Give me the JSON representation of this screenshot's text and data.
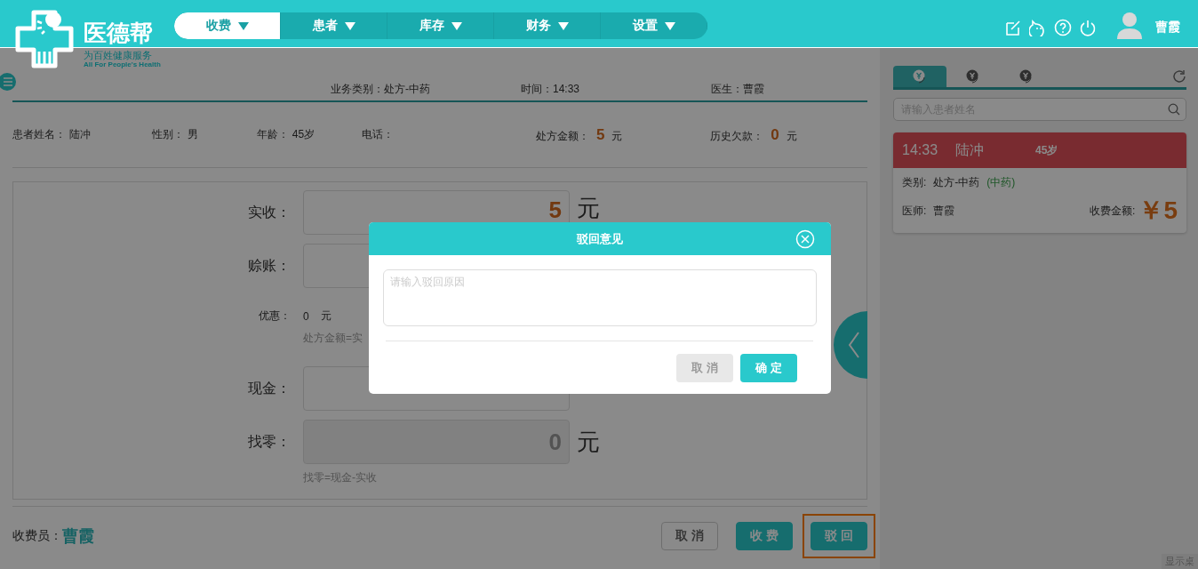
{
  "header": {
    "logo": {
      "name": "医德帮",
      "slogan": "为百姓健康服务",
      "slogan_en": "All For People's Health"
    },
    "nav": [
      {
        "label": "收费",
        "selected": true
      },
      {
        "label": "患者",
        "selected": false
      },
      {
        "label": "库存",
        "selected": false
      },
      {
        "label": "财务",
        "selected": false
      },
      {
        "label": "设置",
        "selected": false
      }
    ],
    "user_name": "曹霞"
  },
  "info_bar": {
    "business_type": "业务类别：处方-中药",
    "time": "时间：14:33",
    "doctor": "医生：曹霞"
  },
  "patient_fields": [
    {
      "kind": "text",
      "label": "患者姓名：",
      "value": "陆冲"
    },
    {
      "kind": "text",
      "label": "性别：",
      "value": "男"
    },
    {
      "kind": "text",
      "label": "年龄：",
      "value": "45岁"
    },
    {
      "kind": "text",
      "label": "电话："
    },
    {
      "kind": "amount",
      "label": "处方金额：",
      "value": "5",
      "unit": "元"
    },
    {
      "kind": "amount",
      "label": "历史欠款：",
      "value": "0",
      "unit": "元"
    }
  ],
  "payment_form": {
    "rows": [
      {
        "kind": "input",
        "label": "实收：",
        "value": "5",
        "unit": "元"
      },
      {
        "kind": "input",
        "label": "赊账："
      },
      {
        "kind": "small",
        "label": "优惠：",
        "value": "0",
        "unit": "元",
        "hint": "处方金额=实"
      },
      {
        "kind": "input",
        "label": "现金："
      },
      {
        "kind": "readonly",
        "label": "找零：",
        "value": "0",
        "unit": "元",
        "hint": "找零=现金-实收"
      }
    ]
  },
  "footer": {
    "cashier_label": "收费员：",
    "cashier_name": "曹霞",
    "buttons": [
      {
        "kind": "outline",
        "label": "取 消",
        "highlighted": false
      },
      {
        "kind": "primary",
        "label": "收 费",
        "highlighted": false
      },
      {
        "kind": "primary",
        "label": "驳 回",
        "highlighted": true
      }
    ]
  },
  "right_panel": {
    "tabs": [
      {
        "selected": true
      },
      {
        "selected": false
      },
      {
        "selected": false
      }
    ],
    "search": {
      "placeholder": "请输入患者姓名"
    },
    "card": {
      "time": "14:33",
      "name": "陆冲",
      "age": "45岁",
      "type_label": "类别:",
      "type_value": "处方-中药",
      "tag": "(中药)",
      "doctor_label": "医师:",
      "doctor_value": "曹霞",
      "amount_label": "收费金额:",
      "amount": "￥5"
    }
  },
  "corner_text": "显示桌",
  "dialog": {
    "title": "驳回意见",
    "placeholder": "请输入驳回原因",
    "buttons": [
      {
        "kind": "cancel",
        "label": "取 消"
      },
      {
        "kind": "primary",
        "label": "确 定"
      }
    ]
  }
}
